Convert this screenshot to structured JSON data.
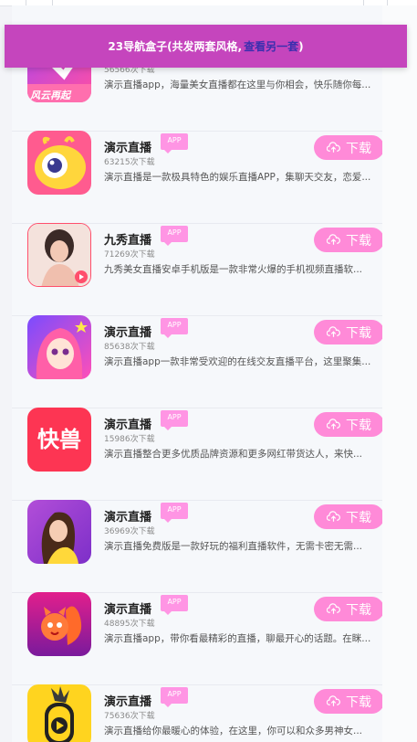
{
  "banner": {
    "text": "23导航盒子(共发两套风格,",
    "link": "查看另一套",
    "close": ")"
  },
  "download_label": "下载",
  "badge_label": "APP",
  "first_icon_text": "风云再起",
  "kuaishou_text": "快兽",
  "apps": [
    {
      "name": "",
      "downloads": "56566次下载",
      "desc": "演示直播app，海量美女直播都在这里与你相会，快乐随你每..."
    },
    {
      "name": "演示直播",
      "downloads": "63215次下载",
      "desc": "演示直播是一款极具特色的娱乐直播APP，集聊天交友，恋爱..."
    },
    {
      "name": "九秀直播",
      "downloads": "71269次下载",
      "desc": "九秀美女直播安卓手机版是一款非常火爆的手机视频直播软..."
    },
    {
      "name": "演示直播",
      "downloads": "85638次下载",
      "desc": "演示直播app一款非常受欢迎的在线交友直播平台，这里聚集..."
    },
    {
      "name": "演示直播",
      "downloads": "15986次下载",
      "desc": "演示直播整合更多优质品牌资源和更多网红带货达人，来快..."
    },
    {
      "name": "演示直播",
      "downloads": "36969次下载",
      "desc": "演示直播免费版是一款好玩的福利直播软件，无需卡密无需..."
    },
    {
      "name": "演示直播",
      "downloads": "48895次下载",
      "desc": "演示直播app，带你看最精彩的直播，聊最开心的话题。在眯..."
    },
    {
      "name": "演示直播",
      "downloads": "75636次下载",
      "desc": "演示直播给你最暖心的体验，在这里，你可以和众多男神女..."
    }
  ]
}
